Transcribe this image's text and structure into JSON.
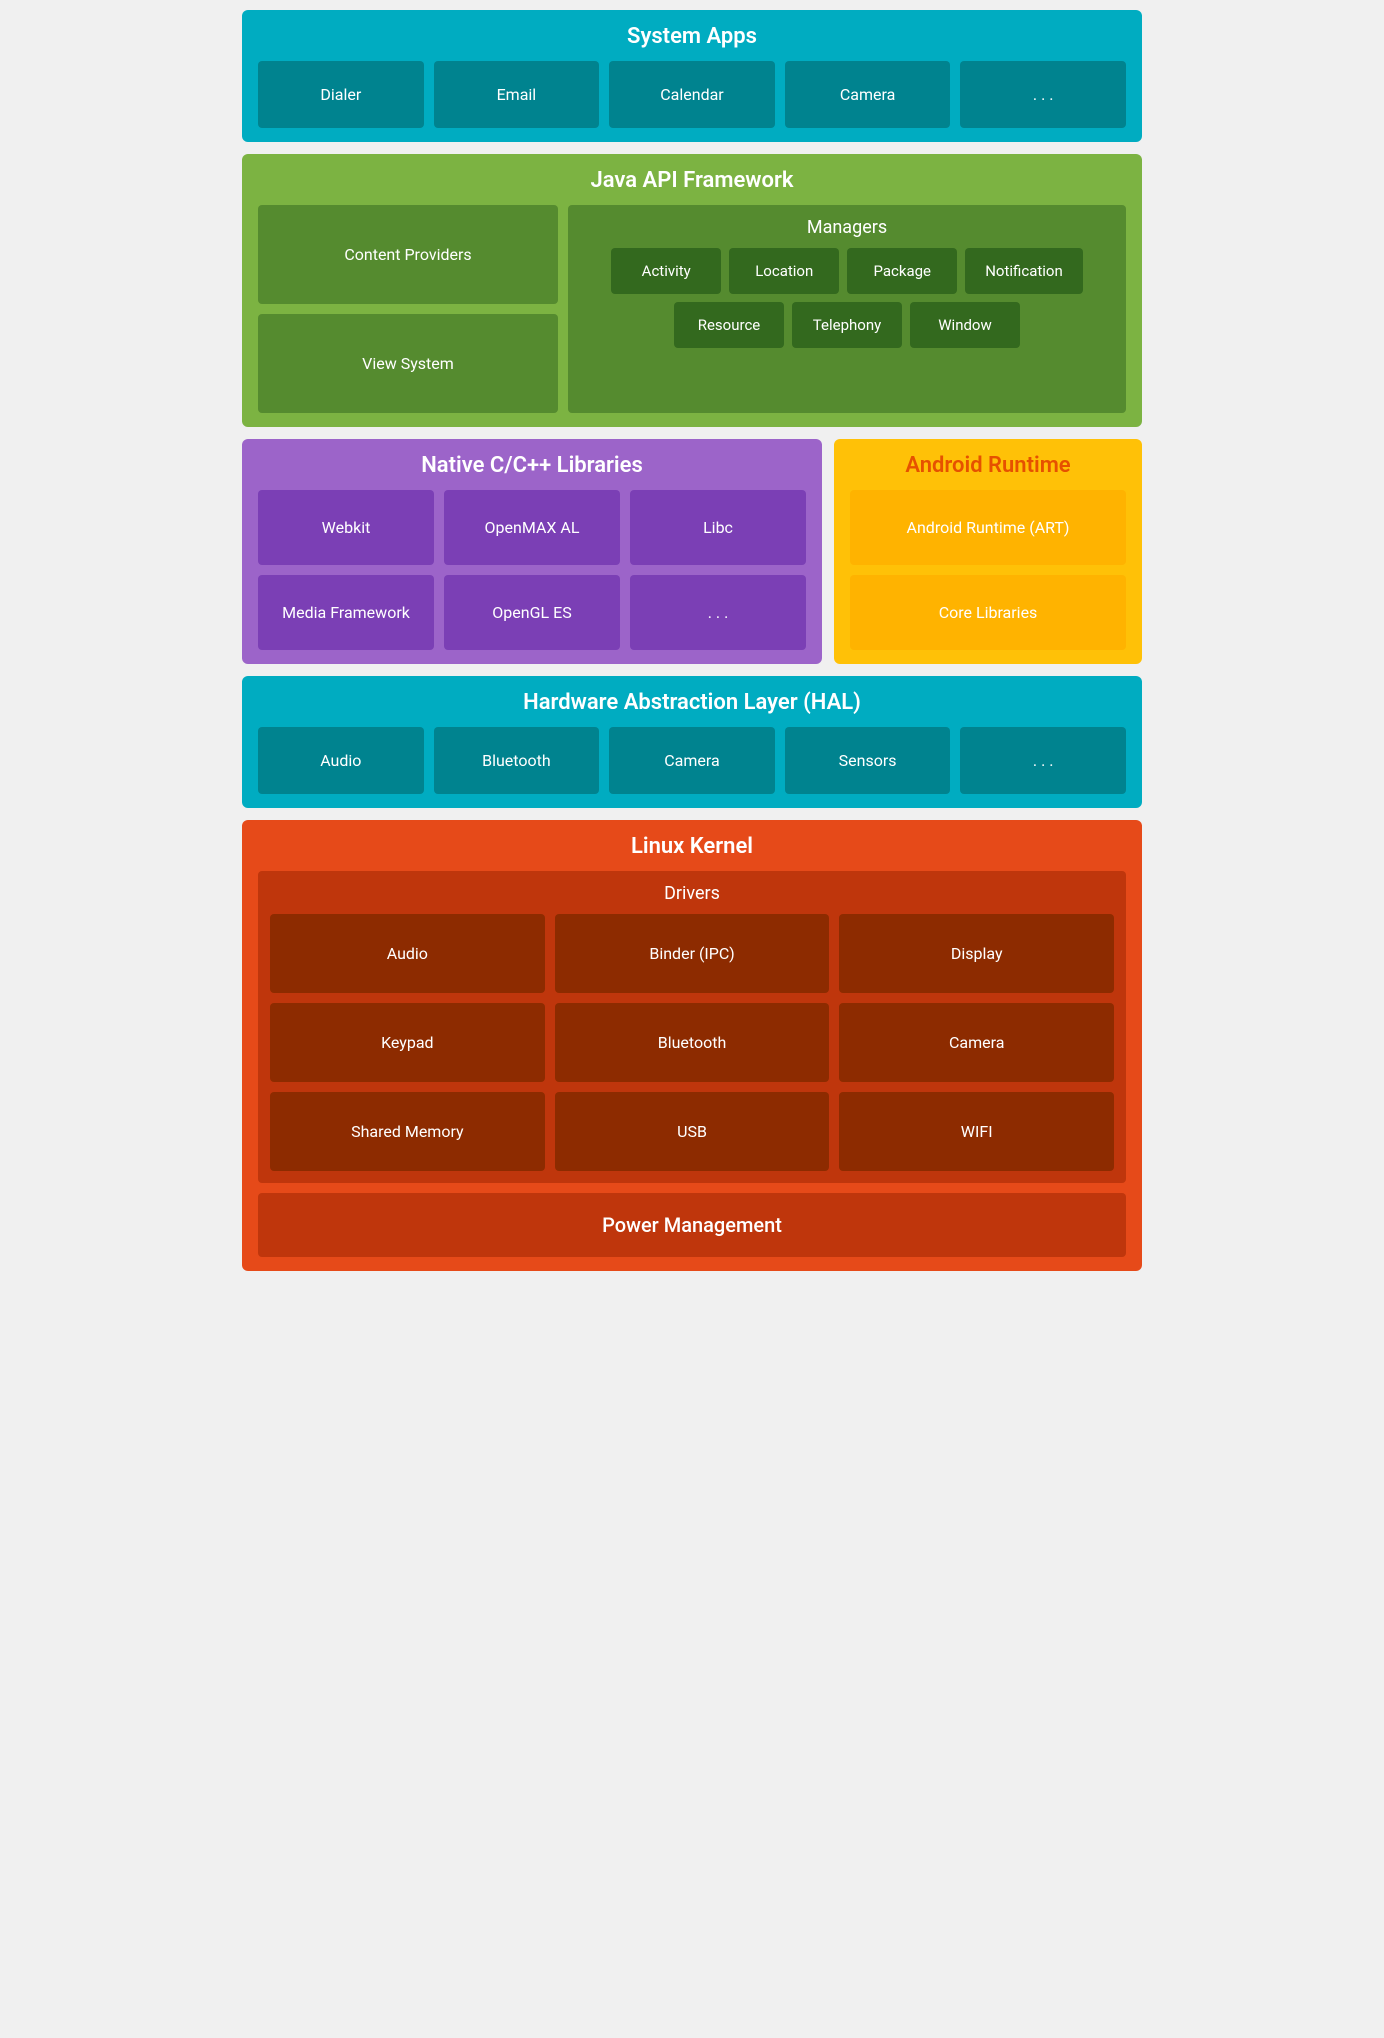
{
  "system_apps": {
    "title": "System Apps",
    "items": [
      "Dialer",
      "Email",
      "Calendar",
      "Camera",
      ". . ."
    ]
  },
  "java_api": {
    "title": "Java API Framework",
    "left_items": [
      "Content Providers",
      "View System"
    ],
    "managers_title": "Managers",
    "managers_rows": [
      [
        "Activity",
        "Location",
        "Package",
        "Notification"
      ],
      [
        "Resource",
        "Telephony",
        "Window"
      ]
    ]
  },
  "native_libs": {
    "title": "Native C/C++ Libraries",
    "rows": [
      [
        "Webkit",
        "OpenMAX AL",
        "Libc"
      ],
      [
        "Media Framework",
        "OpenGL ES",
        ". . ."
      ]
    ]
  },
  "android_runtime": {
    "title": "Android Runtime",
    "items": [
      "Android Runtime (ART)",
      "Core Libraries"
    ]
  },
  "hal": {
    "title": "Hardware Abstraction Layer (HAL)",
    "items": [
      "Audio",
      "Bluetooth",
      "Camera",
      "Sensors",
      ". . ."
    ]
  },
  "linux_kernel": {
    "title": "Linux Kernel",
    "drivers_title": "Drivers",
    "drivers_rows": [
      [
        "Audio",
        "Binder (IPC)",
        "Display"
      ],
      [
        "Keypad",
        "Bluetooth",
        "Camera"
      ],
      [
        "Shared Memory",
        "USB",
        "WIFI"
      ]
    ],
    "power_management": "Power Management"
  }
}
